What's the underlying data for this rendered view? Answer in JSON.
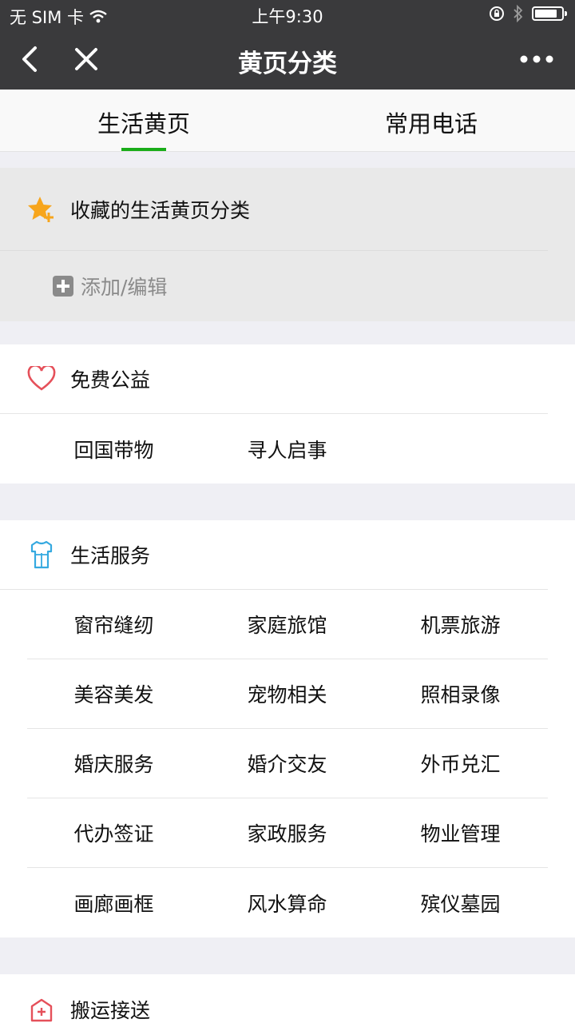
{
  "status": {
    "carrier": "无 SIM 卡",
    "time": "上午9:30",
    "battery_level": 0.85
  },
  "nav": {
    "title": "黄页分类"
  },
  "tabs": [
    {
      "label": "生活黄页",
      "active": true
    },
    {
      "label": "常用电话",
      "active": false
    }
  ],
  "favorites": {
    "title": "收藏的生活黄页分类",
    "add_label": "添加/编辑"
  },
  "sections": [
    {
      "title": "免费公益",
      "icon": "heart-icon",
      "rows": [
        [
          "回国带物",
          "寻人启事"
        ]
      ]
    },
    {
      "title": "生活服务",
      "icon": "clothes-icon",
      "rows": [
        [
          "窗帘缝纫",
          "家庭旅馆",
          "机票旅游"
        ],
        [
          "美容美发",
          "宠物相关",
          "照相录像"
        ],
        [
          "婚庆服务",
          "婚介交友",
          "外币兑汇"
        ],
        [
          "代办签证",
          "家政服务",
          "物业管理"
        ],
        [
          "画廊画框",
          "风水算命",
          "殡仪墓园"
        ]
      ]
    },
    {
      "title": "搬运接送",
      "icon": "moving-icon",
      "rows": []
    }
  ],
  "colors": {
    "accent": "#1aad19",
    "navbar": "#3a3a3c",
    "star": "#f7a51c",
    "heart": "#e5505a",
    "clothes": "#35a9e0"
  }
}
